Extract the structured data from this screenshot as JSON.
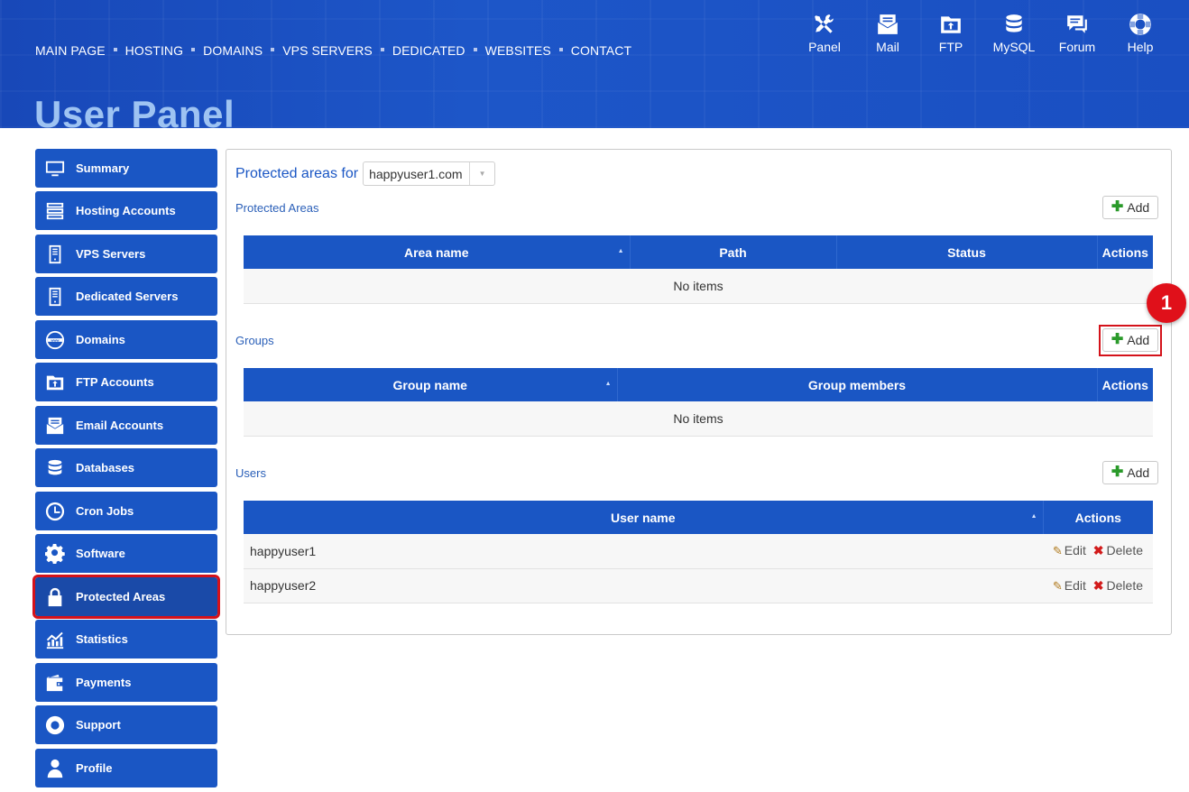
{
  "header": {
    "nav": [
      "MAIN PAGE",
      "HOSTING",
      "DOMAINS",
      "VPS SERVERS",
      "DEDICATED",
      "WEBSITES",
      "CONTACT"
    ],
    "title": "User Panel",
    "quick_links": [
      {
        "label": "Panel",
        "icon": "tools-icon"
      },
      {
        "label": "Mail",
        "icon": "mail-icon"
      },
      {
        "label": "FTP",
        "icon": "folder-icon"
      },
      {
        "label": "MySQL",
        "icon": "database-icon"
      },
      {
        "label": "Forum",
        "icon": "chat-icon"
      },
      {
        "label": "Help",
        "icon": "lifebuoy-icon"
      }
    ]
  },
  "sidebar": {
    "items": [
      {
        "label": "Summary",
        "icon": "monitor-icon"
      },
      {
        "label": "Hosting Accounts",
        "icon": "server-rack-icon"
      },
      {
        "label": "VPS Servers",
        "icon": "server-icon"
      },
      {
        "label": "Dedicated Servers",
        "icon": "server-icon"
      },
      {
        "label": "Domains",
        "icon": "www-globe-icon"
      },
      {
        "label": "FTP Accounts",
        "icon": "folder-icon"
      },
      {
        "label": "Email Accounts",
        "icon": "mail-icon"
      },
      {
        "label": "Databases",
        "icon": "database-icon"
      },
      {
        "label": "Cron Jobs",
        "icon": "clock-icon"
      },
      {
        "label": "Software",
        "icon": "gear-icon"
      },
      {
        "label": "Protected Areas",
        "icon": "lock-icon"
      },
      {
        "label": "Statistics",
        "icon": "chart-icon"
      },
      {
        "label": "Payments",
        "icon": "wallet-icon"
      },
      {
        "label": "Support",
        "icon": "lifebuoy-icon"
      },
      {
        "label": "Profile",
        "icon": "user-icon"
      }
    ],
    "active": "Protected Areas"
  },
  "main": {
    "for_label": "Protected areas for",
    "domain_select": "happyuser1.com",
    "add_label": "Add",
    "areas": {
      "title": "Protected Areas",
      "columns": [
        "Area name",
        "Path",
        "Status",
        "Actions"
      ],
      "empty": "No items"
    },
    "groups": {
      "title": "Groups",
      "columns": [
        "Group name",
        "Group members",
        "Actions"
      ],
      "empty": "No items"
    },
    "users": {
      "title": "Users",
      "columns": [
        "User name",
        "Actions"
      ],
      "rows": [
        {
          "name": "happyuser1"
        },
        {
          "name": "happyuser2"
        }
      ],
      "edit_label": "Edit",
      "delete_label": "Delete"
    },
    "annotation_badge": "1"
  },
  "colors": {
    "accent": "#1a56c4",
    "highlight": "#d4121a",
    "title": "#9ec3f2"
  }
}
